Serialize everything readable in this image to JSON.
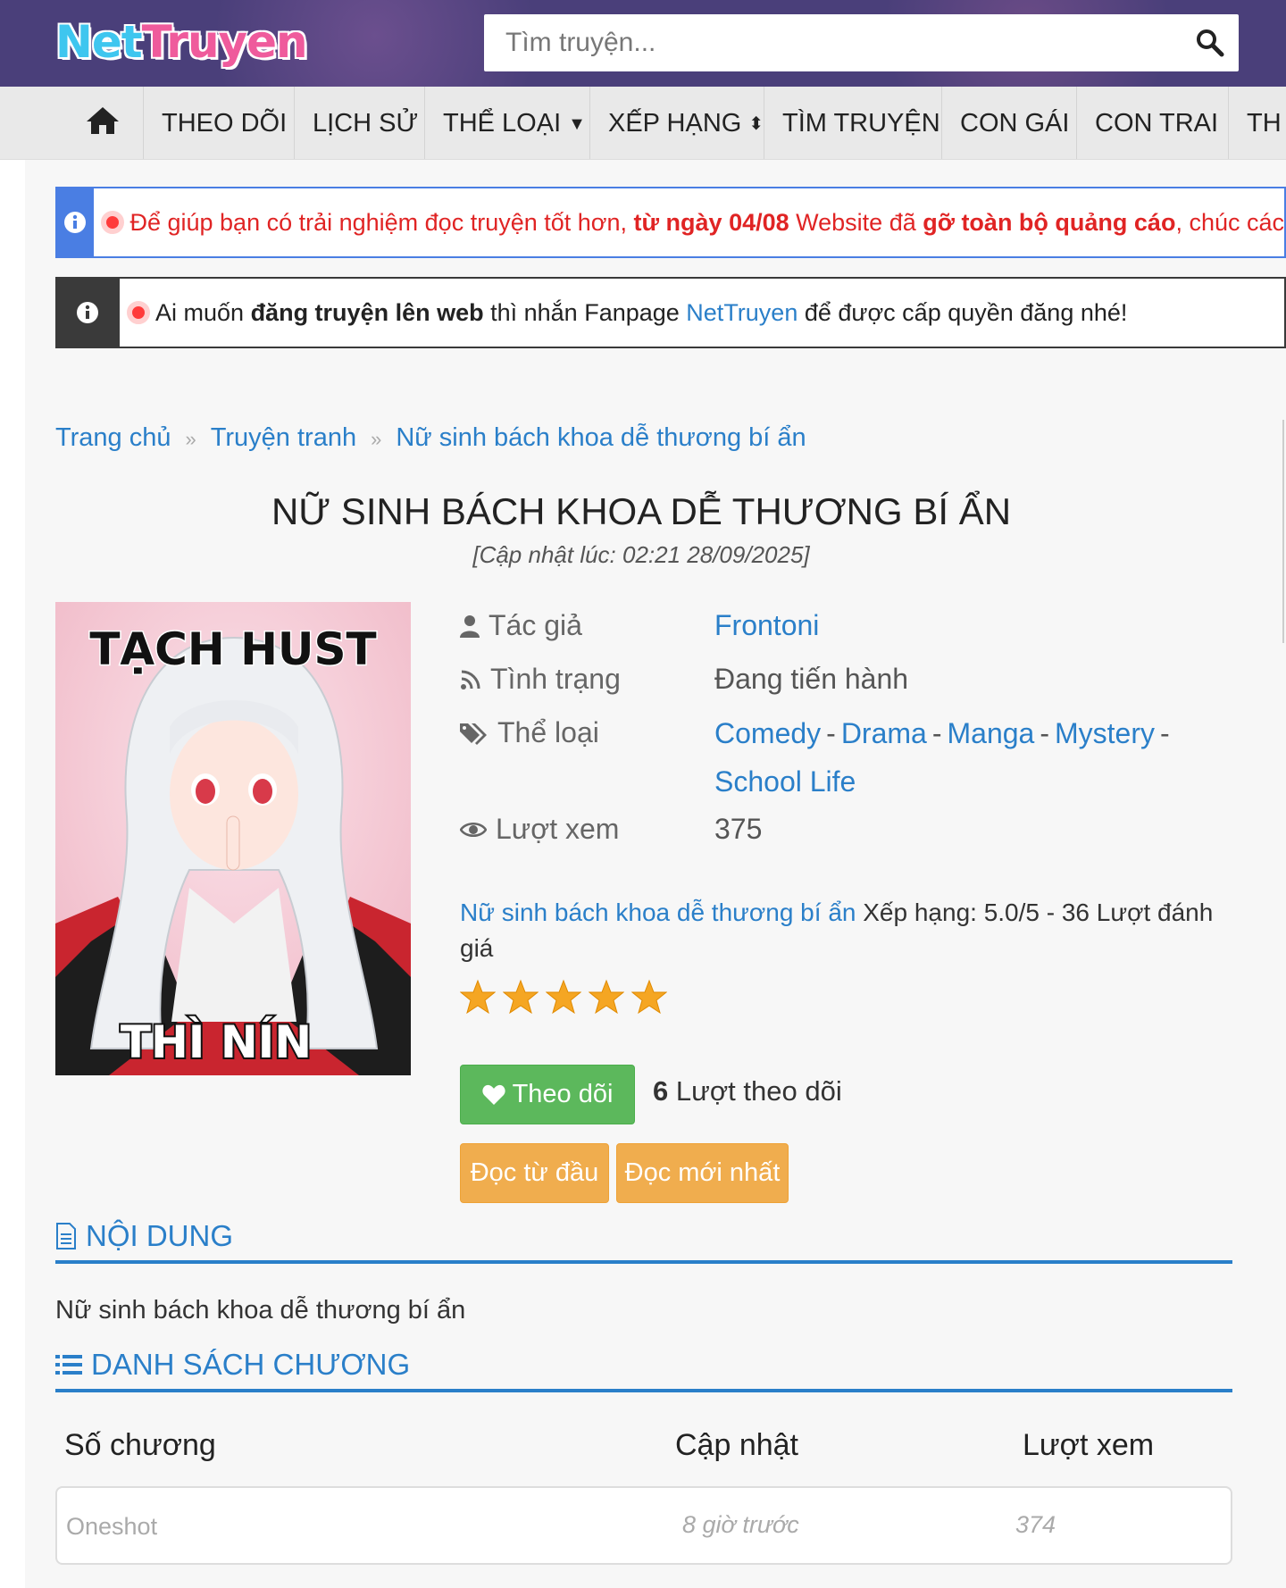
{
  "header": {
    "logo_part1": "Net",
    "logo_part2": "Truyen",
    "search_placeholder": "Tìm truyện..."
  },
  "nav": {
    "items": [
      "THEO DÕI",
      "LỊCH SỬ",
      "THỂ LOẠI",
      "XẾP HẠNG",
      "TÌM TRUYỆN",
      "CON GÁI",
      "CON TRAI",
      "TH"
    ]
  },
  "alerts": {
    "a1_part1": "Để giúp bạn có trải nghiệm đọc truyện tốt hơn, ",
    "a1_bold1": "từ ngày 04/08",
    "a1_part2": " Website đã ",
    "a1_bold2": "gỡ toàn bộ quảng cáo",
    "a1_part3": ", chúc các",
    "a2_part1": "Ai muốn ",
    "a2_bold": "đăng truyện lên web",
    "a2_part2": " thì nhắn Fanpage ",
    "a2_link": "NetTruyen",
    "a2_part3": " để được cấp quyền đăng nhé!"
  },
  "breadcrumb": [
    "Trang chủ",
    "Truyện tranh",
    "Nữ sinh bách khoa dễ thương bí ẩn"
  ],
  "comic": {
    "title": "NỮ SINH BÁCH KHOA DỄ THƯƠNG BÍ ẨN",
    "updated": "[Cập nhật lúc: 02:21 28/09/2025]",
    "cover_top_text": "TẠCH HUST",
    "cover_bottom_text": "THÌ NÍN",
    "author_label": "Tác giả",
    "author": "Frontoni",
    "status_label": "Tình trạng",
    "status": "Đang tiến hành",
    "genre_label": "Thể loại",
    "genres": [
      "Comedy",
      "Drama",
      "Manga",
      "Mystery",
      "School Life"
    ],
    "views_label": "Lượt xem",
    "views": "375",
    "rating_name": "Nữ sinh bách khoa dễ thương bí ẩn",
    "rating_text": " Xếp hạng: 5.0/5 - 36 Lượt đánh giá",
    "stars": 5,
    "follow_button": "Theo dõi",
    "follow_count": "6",
    "follow_text": " Lượt theo dõi",
    "read_first": "Đọc từ đầu",
    "read_latest": "Đọc mới nhất"
  },
  "content": {
    "heading": "NỘI DUNG",
    "text": "Nữ sinh bách khoa dễ thương bí ẩn"
  },
  "chapters": {
    "heading": "DANH SÁCH CHƯƠNG",
    "col_chapter": "Số chương",
    "col_updated": "Cập nhật",
    "col_views": "Lượt xem",
    "rows": [
      {
        "name": "Oneshot",
        "updated": "8 giờ trước",
        "views": "374"
      }
    ]
  },
  "colors": {
    "header_bg": "#4a3f7a",
    "link": "#2a7fc9",
    "alert_red": "#e02424",
    "follow_green": "#5cb85c",
    "read_orange": "#f0ad4e",
    "star": "#f5a623"
  }
}
